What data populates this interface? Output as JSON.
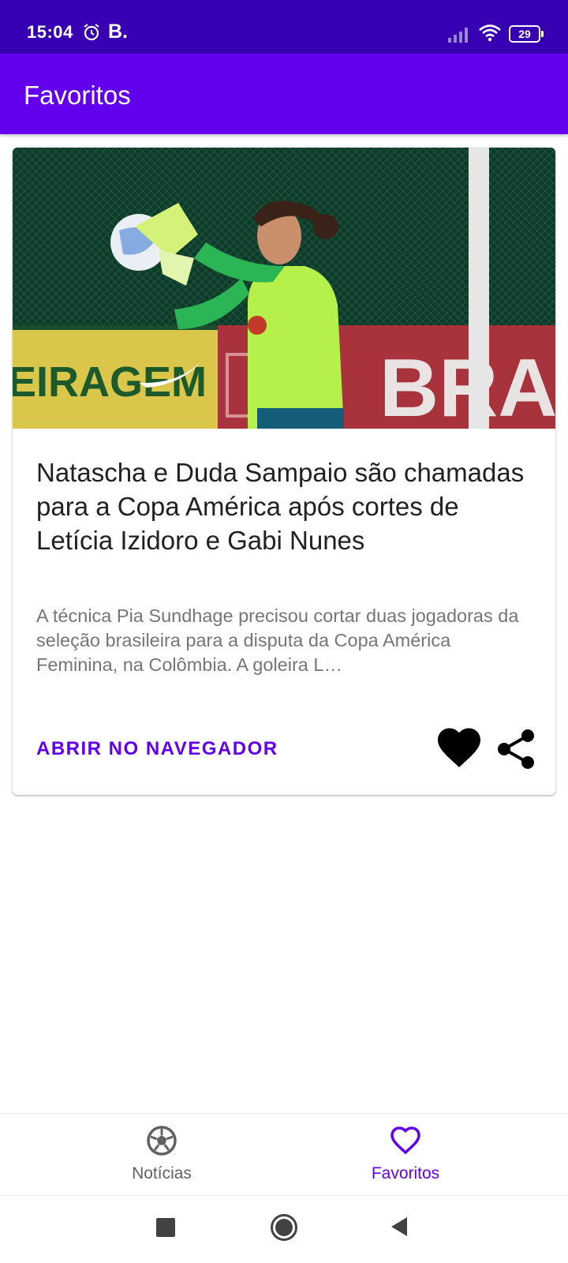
{
  "status_bar": {
    "time": "15:04",
    "app_badge": "B.",
    "battery_level": "29",
    "icons": [
      "alarm-icon",
      "signal-icon",
      "wifi-icon",
      "battery-icon"
    ]
  },
  "app_bar": {
    "title": "Favoritos"
  },
  "card": {
    "image_desc_icon": "goalkeeper-photo",
    "title": "Natascha e Duda Sampaio são chamadas para a Copa América após cortes de Letícia Izidoro e Gabi Nunes",
    "summary": "A técnica Pia Sundhage precisou cortar duas jogadoras da seleção brasileira para a disputa da Copa América Feminina, na Colômbia. A goleira L…",
    "open_label": "ABRIR NO NAVEGADOR",
    "favorite_icon": "heart-filled-icon",
    "share_icon": "share-icon",
    "image_text_left": "EIRAGEM",
    "image_text_right": "BRAH"
  },
  "bottom_nav": {
    "items": [
      {
        "label": "Notícias",
        "icon": "soccer-ball-icon",
        "selected": false
      },
      {
        "label": "Favoritos",
        "icon": "heart-outline-icon",
        "selected": true
      }
    ]
  },
  "colors": {
    "status_bar": "#3700b3",
    "primary": "#6200ee",
    "title_text": "#212121",
    "summary_text": "#757575"
  }
}
